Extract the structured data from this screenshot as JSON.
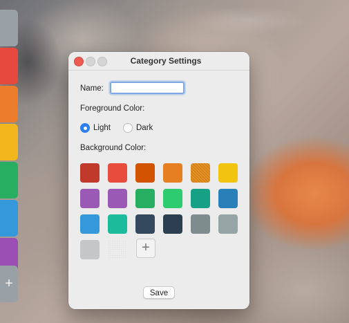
{
  "window": {
    "title": "Category Settings"
  },
  "sidebar": {
    "category_tabs": [
      {
        "color": "#9aa1a6"
      },
      {
        "color": "#e7493e"
      },
      {
        "color": "#ec7d2c"
      },
      {
        "color": "#f2b71c"
      },
      {
        "color": "#27ae60"
      },
      {
        "color": "#3498db"
      },
      {
        "color": "#9b4fb5"
      }
    ],
    "add_tab_symbol": "+"
  },
  "form": {
    "name_label": "Name:",
    "name_value": "",
    "foreground_label": "Foreground Color:",
    "foreground_options": [
      {
        "label": "Light",
        "selected": true
      },
      {
        "label": "Dark",
        "selected": false
      }
    ],
    "background_label": "Background Color:",
    "background_swatches": [
      {
        "color": "#c0392b"
      },
      {
        "color": "#e74c3c"
      },
      {
        "color": "#d35400"
      },
      {
        "color": "#e67e22"
      },
      {
        "color": "#e69022",
        "pattern": "hatched"
      },
      {
        "color": "#f1c40f"
      },
      {
        "color": "#9b59b6"
      },
      {
        "color": "#9b59b6"
      },
      {
        "color": "#27ae60"
      },
      {
        "color": "#2ecc71"
      },
      {
        "color": "#16a085"
      },
      {
        "color": "#2980b9"
      },
      {
        "color": "#3498db"
      },
      {
        "color": "#1abc9c"
      },
      {
        "color": "#34495e"
      },
      {
        "color": "#2c3e50"
      },
      {
        "color": "#7f8c8d"
      },
      {
        "color": "#95a5a6"
      },
      {
        "color": "#c4c6c8"
      },
      {
        "color": "#ececec",
        "pattern": "dotted"
      }
    ],
    "add_color_symbol": "+",
    "save_label": "Save"
  }
}
